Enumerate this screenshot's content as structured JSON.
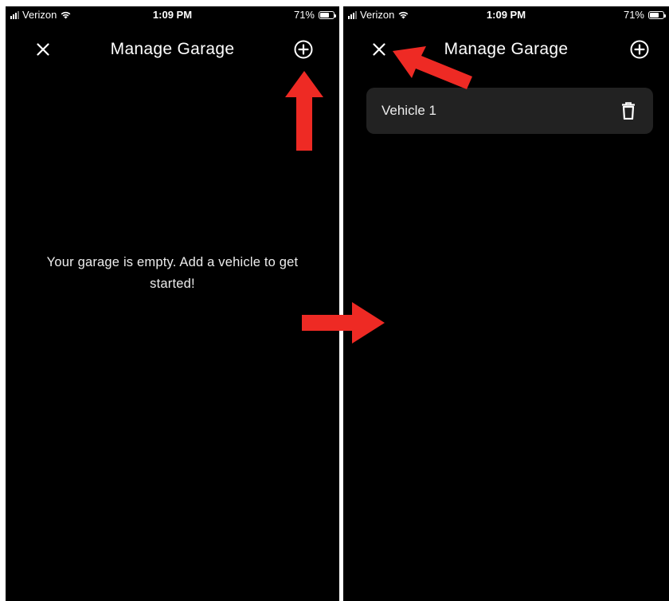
{
  "status_bar": {
    "carrier": "Verizon",
    "time": "1:09 PM",
    "battery": "71%",
    "battery_level": 0.71
  },
  "nav": {
    "title": "Manage Garage",
    "close_icon": "close-icon",
    "add_icon": "add-circle-icon"
  },
  "left_screen": {
    "empty_message": "Your garage is empty. Add a vehicle to get started!"
  },
  "right_screen": {
    "vehicles": [
      {
        "name": "Vehicle 1",
        "action_icon": "trash-icon"
      }
    ]
  },
  "annotation_color": "#ee2a24",
  "page_colors": {
    "background": "#000000",
    "card": "#222222",
    "text": "#ffffff"
  }
}
